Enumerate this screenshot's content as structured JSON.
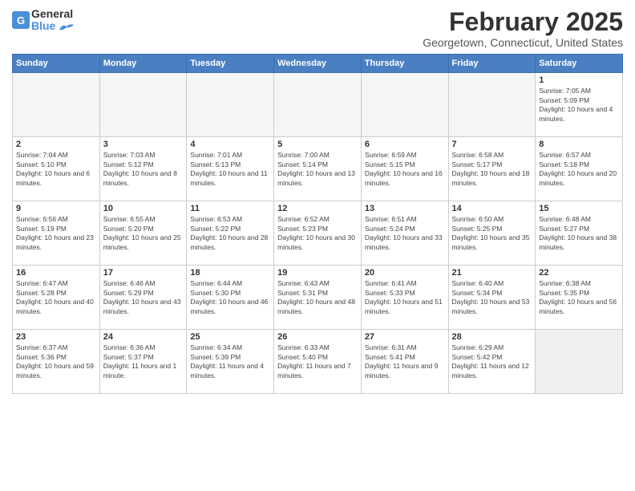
{
  "header": {
    "logo_line1": "General",
    "logo_line2": "Blue",
    "month": "February 2025",
    "location": "Georgetown, Connecticut, United States"
  },
  "weekdays": [
    "Sunday",
    "Monday",
    "Tuesday",
    "Wednesday",
    "Thursday",
    "Friday",
    "Saturday"
  ],
  "weeks": [
    [
      {
        "day": "",
        "info": ""
      },
      {
        "day": "",
        "info": ""
      },
      {
        "day": "",
        "info": ""
      },
      {
        "day": "",
        "info": ""
      },
      {
        "day": "",
        "info": ""
      },
      {
        "day": "",
        "info": ""
      },
      {
        "day": "1",
        "info": "Sunrise: 7:05 AM\nSunset: 5:09 PM\nDaylight: 10 hours and 4 minutes."
      }
    ],
    [
      {
        "day": "2",
        "info": "Sunrise: 7:04 AM\nSunset: 5:10 PM\nDaylight: 10 hours and 6 minutes."
      },
      {
        "day": "3",
        "info": "Sunrise: 7:03 AM\nSunset: 5:12 PM\nDaylight: 10 hours and 8 minutes."
      },
      {
        "day": "4",
        "info": "Sunrise: 7:01 AM\nSunset: 5:13 PM\nDaylight: 10 hours and 11 minutes."
      },
      {
        "day": "5",
        "info": "Sunrise: 7:00 AM\nSunset: 5:14 PM\nDaylight: 10 hours and 13 minutes."
      },
      {
        "day": "6",
        "info": "Sunrise: 6:59 AM\nSunset: 5:15 PM\nDaylight: 10 hours and 16 minutes."
      },
      {
        "day": "7",
        "info": "Sunrise: 6:58 AM\nSunset: 5:17 PM\nDaylight: 10 hours and 18 minutes."
      },
      {
        "day": "8",
        "info": "Sunrise: 6:57 AM\nSunset: 5:18 PM\nDaylight: 10 hours and 20 minutes."
      }
    ],
    [
      {
        "day": "9",
        "info": "Sunrise: 6:56 AM\nSunset: 5:19 PM\nDaylight: 10 hours and 23 minutes."
      },
      {
        "day": "10",
        "info": "Sunrise: 6:55 AM\nSunset: 5:20 PM\nDaylight: 10 hours and 25 minutes."
      },
      {
        "day": "11",
        "info": "Sunrise: 6:53 AM\nSunset: 5:22 PM\nDaylight: 10 hours and 28 minutes."
      },
      {
        "day": "12",
        "info": "Sunrise: 6:52 AM\nSunset: 5:23 PM\nDaylight: 10 hours and 30 minutes."
      },
      {
        "day": "13",
        "info": "Sunrise: 6:51 AM\nSunset: 5:24 PM\nDaylight: 10 hours and 33 minutes."
      },
      {
        "day": "14",
        "info": "Sunrise: 6:50 AM\nSunset: 5:25 PM\nDaylight: 10 hours and 35 minutes."
      },
      {
        "day": "15",
        "info": "Sunrise: 6:48 AM\nSunset: 5:27 PM\nDaylight: 10 hours and 38 minutes."
      }
    ],
    [
      {
        "day": "16",
        "info": "Sunrise: 6:47 AM\nSunset: 5:28 PM\nDaylight: 10 hours and 40 minutes."
      },
      {
        "day": "17",
        "info": "Sunrise: 6:46 AM\nSunset: 5:29 PM\nDaylight: 10 hours and 43 minutes."
      },
      {
        "day": "18",
        "info": "Sunrise: 6:44 AM\nSunset: 5:30 PM\nDaylight: 10 hours and 46 minutes."
      },
      {
        "day": "19",
        "info": "Sunrise: 6:43 AM\nSunset: 5:31 PM\nDaylight: 10 hours and 48 minutes."
      },
      {
        "day": "20",
        "info": "Sunrise: 6:41 AM\nSunset: 5:33 PM\nDaylight: 10 hours and 51 minutes."
      },
      {
        "day": "21",
        "info": "Sunrise: 6:40 AM\nSunset: 5:34 PM\nDaylight: 10 hours and 53 minutes."
      },
      {
        "day": "22",
        "info": "Sunrise: 6:38 AM\nSunset: 5:35 PM\nDaylight: 10 hours and 56 minutes."
      }
    ],
    [
      {
        "day": "23",
        "info": "Sunrise: 6:37 AM\nSunset: 5:36 PM\nDaylight: 10 hours and 59 minutes."
      },
      {
        "day": "24",
        "info": "Sunrise: 6:36 AM\nSunset: 5:37 PM\nDaylight: 11 hours and 1 minute."
      },
      {
        "day": "25",
        "info": "Sunrise: 6:34 AM\nSunset: 5:39 PM\nDaylight: 11 hours and 4 minutes."
      },
      {
        "day": "26",
        "info": "Sunrise: 6:33 AM\nSunset: 5:40 PM\nDaylight: 11 hours and 7 minutes."
      },
      {
        "day": "27",
        "info": "Sunrise: 6:31 AM\nSunset: 5:41 PM\nDaylight: 11 hours and 9 minutes."
      },
      {
        "day": "28",
        "info": "Sunrise: 6:29 AM\nSunset: 5:42 PM\nDaylight: 11 hours and 12 minutes."
      },
      {
        "day": "",
        "info": ""
      }
    ]
  ]
}
